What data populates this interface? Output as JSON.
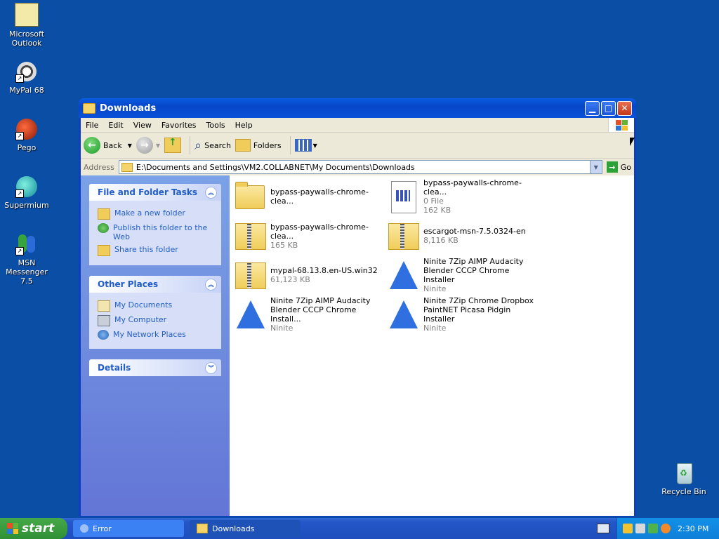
{
  "desktop": {
    "icons": [
      {
        "label": "Microsoft Outlook"
      },
      {
        "label": "MyPal 68"
      },
      {
        "label": "Pego"
      },
      {
        "label": "Supermium"
      },
      {
        "label": "MSN Messenger 7.5"
      },
      {
        "label": "Recycle Bin"
      }
    ]
  },
  "window": {
    "title": "Downloads",
    "menu": [
      "File",
      "Edit",
      "View",
      "Favorites",
      "Tools",
      "Help"
    ],
    "toolbar": {
      "back": "Back",
      "search": "Search",
      "folders": "Folders"
    },
    "address": {
      "label": "Address",
      "path": "E:\\Documents and Settings\\VM2.COLLABNET\\My Documents\\Downloads",
      "go": "Go"
    },
    "tasks": {
      "file_folder": {
        "title": "File and Folder Tasks",
        "items": [
          "Make a new folder",
          "Publish this folder to the Web",
          "Share this folder"
        ]
      },
      "other_places": {
        "title": "Other Places",
        "items": [
          "My Documents",
          "My Computer",
          "My Network Places"
        ]
      },
      "details": {
        "title": "Details"
      }
    },
    "files": [
      {
        "name": "bypass-paywalls-chrome-clea...",
        "meta": "",
        "icon": "folder-icon"
      },
      {
        "name": "bypass-paywalls-chrome-clea...",
        "meta": "0 File",
        "meta2": "162 KB",
        "icon": "file-icon"
      },
      {
        "name": "bypass-paywalls-chrome-clea...",
        "meta": "165 KB",
        "icon": "zip-icon"
      },
      {
        "name": "escargot-msn-7.5.0324-en",
        "meta": "8,116 KB",
        "icon": "zip-icon"
      },
      {
        "name": "mypal-68.13.8.en-US.win32",
        "meta": "61,123 KB",
        "icon": "zip-icon"
      },
      {
        "name": "Ninite 7Zip AIMP Audacity",
        "name2": "Blender CCCP Chrome Installer",
        "meta": "Ninite",
        "icon": "ninite-icon"
      },
      {
        "name": "Ninite 7Zip AIMP Audacity",
        "name2": "Blender CCCP Chrome Install...",
        "meta": "Ninite",
        "icon": "ninite-icon"
      },
      {
        "name": "Ninite 7Zip Chrome Dropbox",
        "name2": "PaintNET Picasa Pidgin Installer",
        "meta": "Ninite",
        "icon": "ninite-icon"
      }
    ]
  },
  "taskbar": {
    "start": "start",
    "buttons": [
      {
        "label": "Error"
      },
      {
        "label": "Downloads"
      }
    ],
    "clock": "2:30 PM"
  },
  "colors": {
    "desktop": "#0b4ea6",
    "title_bar": "#0646c9",
    "task_pane_link": "#215dc6"
  }
}
